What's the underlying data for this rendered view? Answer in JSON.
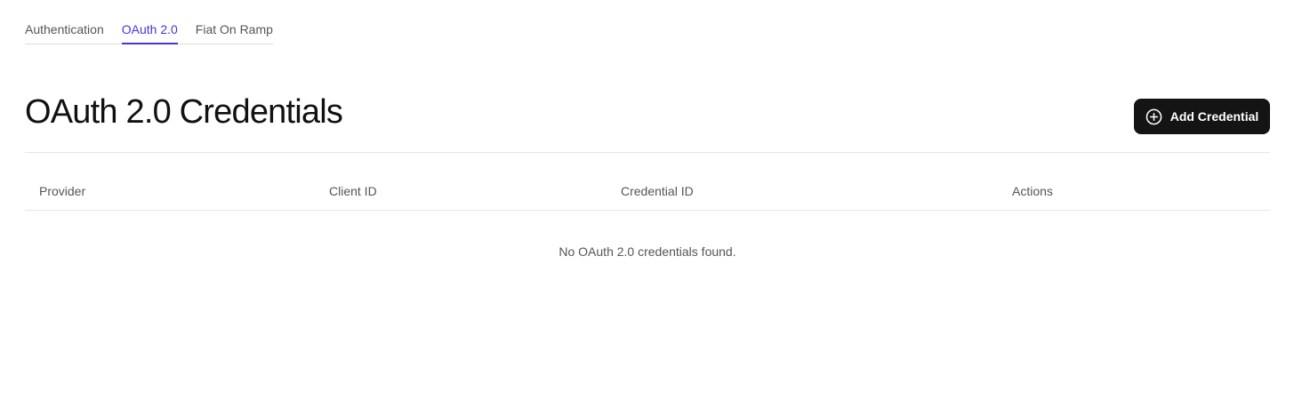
{
  "tabs": [
    {
      "label": "Authentication",
      "active": false
    },
    {
      "label": "OAuth 2.0",
      "active": true
    },
    {
      "label": "Fiat On Ramp",
      "active": false
    }
  ],
  "header": {
    "title": "OAuth 2.0 Credentials",
    "add_button_label": "Add Credential",
    "add_button_icon": "plus-circle-icon"
  },
  "table": {
    "columns": [
      "Provider",
      "Client ID",
      "Credential ID",
      "Actions"
    ],
    "rows": [],
    "empty_message": "No OAuth 2.0 credentials found."
  },
  "colors": {
    "accent": "#4535e0",
    "button_bg": "#141414",
    "muted_text": "#555555",
    "divider": "#e6e6e6"
  }
}
